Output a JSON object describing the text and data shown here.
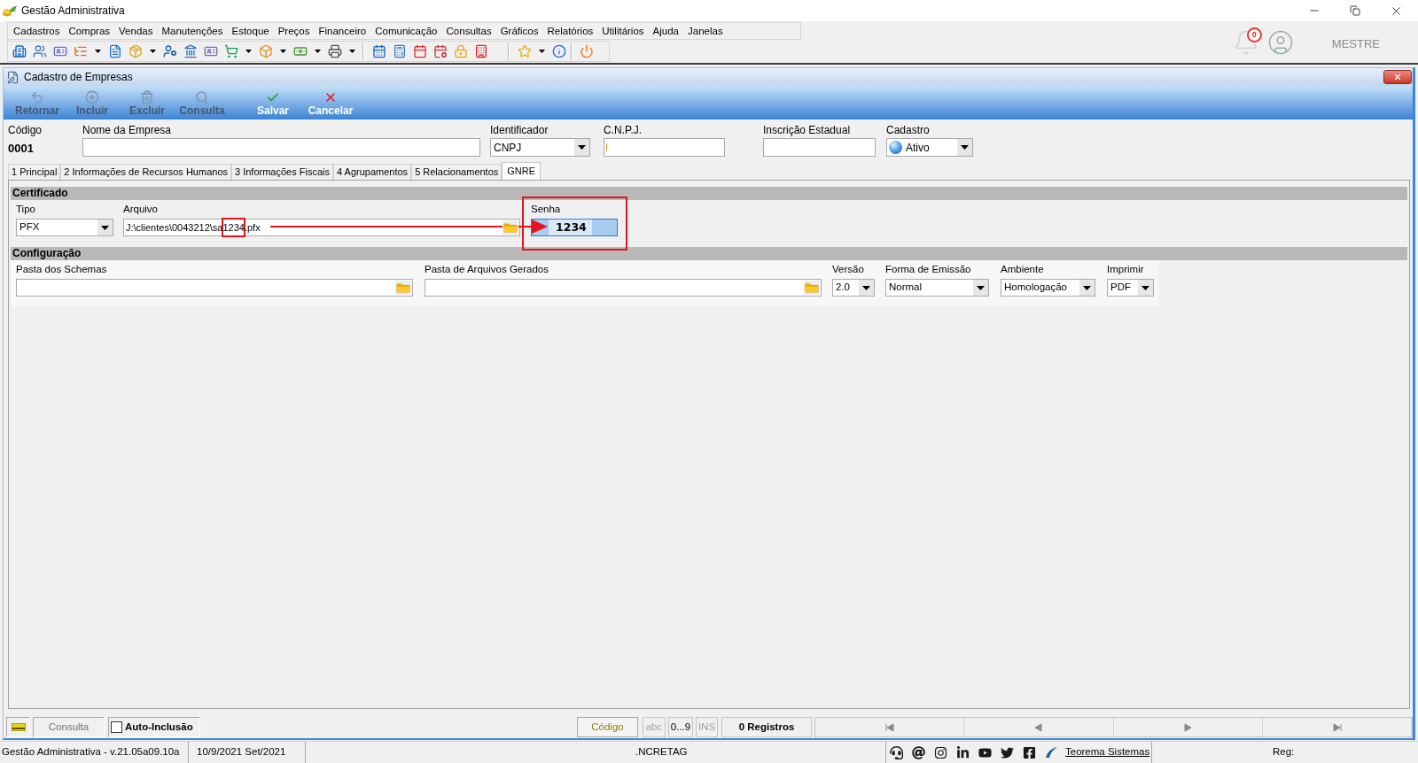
{
  "app_window": {
    "title": "Gestão Administrativa"
  },
  "menu": [
    "Cadastros",
    "Compras",
    "Vendas",
    "Manutenções",
    "Estoque",
    "Preços",
    "Financeiro",
    "Comunicação",
    "Consultas",
    "Gráficos",
    "Relatórios",
    "Utilitários",
    "Ajuda",
    "Janelas"
  ],
  "user_area": {
    "notifications": "0",
    "user_name": "MESTRE"
  },
  "form_window": {
    "title": "Cadastro de Empresas",
    "actions": [
      {
        "kind": "back",
        "label": "Retornar",
        "disabled": true
      },
      {
        "kind": "add",
        "label": "Incluir",
        "disabled": true
      },
      {
        "kind": "delete",
        "label": "Excluir",
        "disabled": true
      },
      {
        "kind": "search",
        "label": "Consulta",
        "disabled": true
      },
      {
        "kind": "save",
        "label": "Salvar",
        "disabled": false
      },
      {
        "kind": "cancel",
        "label": "Cancelar",
        "disabled": false
      }
    ],
    "header": {
      "code": {
        "label": "Código",
        "value": "0001"
      },
      "fields": [
        {
          "kind": "text",
          "label": "Nome da Empresa",
          "caret": false
        },
        {
          "kind": "select",
          "label": "Identificador",
          "value": "CNPJ",
          "caret": false
        },
        {
          "kind": "text",
          "label": "C.N.P.J.",
          "caret": true
        },
        {
          "kind": "text",
          "label": "Inscrição Estadual",
          "caret": false
        },
        {
          "kind": "status-select",
          "label": "Cadastro",
          "value": "Ativo",
          "caret": false
        }
      ]
    },
    "tabs": [
      {
        "label": "1 Principal",
        "selected": false
      },
      {
        "label": "2 Informações de Recursos Humanos",
        "selected": false
      },
      {
        "label": "3 Informações Fiscais",
        "selected": false
      },
      {
        "label": "4 Agrupamentos",
        "selected": false
      },
      {
        "label": "5 Relacionamentos",
        "selected": false
      },
      {
        "label": "GNRE",
        "selected": true
      }
    ],
    "sections": [
      {
        "title": "Certificado",
        "fields": [
          {
            "kind": "select",
            "label": "Tipo",
            "value": "PFX",
            "focused": false
          },
          {
            "kind": "file",
            "label": "Arquivo",
            "value": "J:\\clientes\\0043212\\sa1234.pfx",
            "focused": false
          },
          {
            "kind": "password",
            "label": "Senha",
            "value": "1234",
            "focused": true
          }
        ]
      },
      {
        "title": "Configuração",
        "fields": [
          {
            "kind": "folder",
            "label": "Pasta dos Schemas",
            "focused": false
          },
          {
            "kind": "folder",
            "label": "Pasta de Arquivos Gerados",
            "focused": false
          },
          {
            "kind": "select",
            "label": "Versão",
            "value": "2.0",
            "focused": false
          },
          {
            "kind": "select",
            "label": "Forma de Emissão",
            "value": "Normal",
            "focused": false
          },
          {
            "kind": "select",
            "label": "Ambiente",
            "value": "Homologação",
            "focused": false
          },
          {
            "kind": "select",
            "label": "Imprimir",
            "value": "PDF",
            "focused": false
          }
        ]
      }
    ],
    "navigator": {
      "mode": "Consulta",
      "auto_include": {
        "label": "Auto-Inclusão",
        "checked": false
      },
      "search_field": "Código",
      "indicators": [
        {
          "label": "abc",
          "on": false
        },
        {
          "label": "0...9",
          "on": true
        },
        {
          "label": "INS",
          "on": false
        }
      ],
      "records": "0 Registros"
    }
  },
  "status_bar": {
    "version": "Gestão Administrativa - v.21.05a09.10a",
    "period": "10/9/2021 Set/2021",
    "message": ".NCRETAG",
    "link": "Teorema Sistemas",
    "reg_label": "Reg:"
  }
}
